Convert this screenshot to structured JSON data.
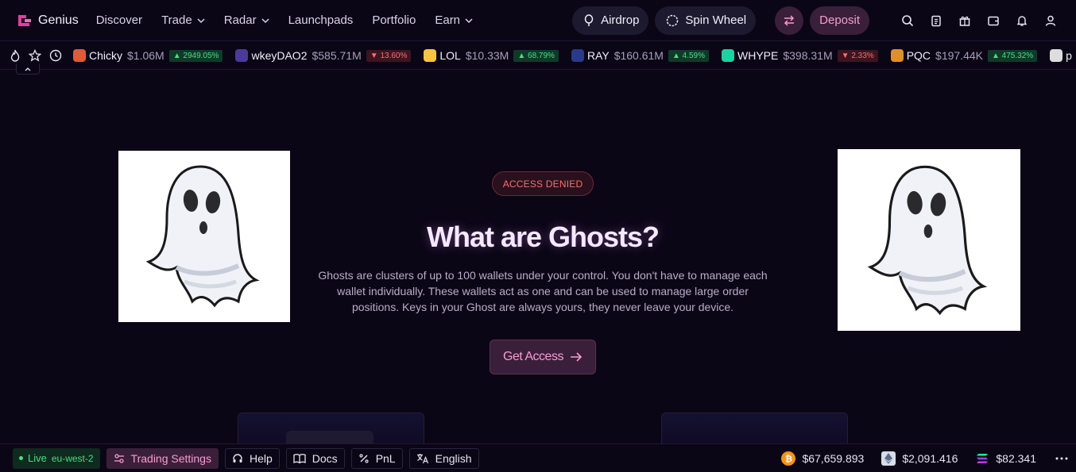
{
  "nav": {
    "brand": "Genius",
    "items": [
      {
        "label": "Discover",
        "dropdown": false
      },
      {
        "label": "Trade",
        "dropdown": true
      },
      {
        "label": "Radar",
        "dropdown": true
      },
      {
        "label": "Launchpads",
        "dropdown": false
      },
      {
        "label": "Portfolio",
        "dropdown": false
      },
      {
        "label": "Earn",
        "dropdown": true
      }
    ],
    "airdrop": "Airdrop",
    "spin_wheel": "Spin Wheel",
    "deposit": "Deposit"
  },
  "ticker": [
    {
      "symbol": "Chicky",
      "mc": "$1.06M",
      "change": "2949.05%",
      "dir": "up",
      "color": "#e05a3a"
    },
    {
      "symbol": "wkeyDAO2",
      "mc": "$585.71M",
      "change": "13.60%",
      "dir": "down",
      "color": "#4a3a9a"
    },
    {
      "symbol": "LOL",
      "mc": "$10.33M",
      "change": "68.79%",
      "dir": "up",
      "color": "#f5c542"
    },
    {
      "symbol": "RAY",
      "mc": "$160.61M",
      "change": "4.59%",
      "dir": "up",
      "color": "#2a3a8a"
    },
    {
      "symbol": "WHYPE",
      "mc": "$398.31M",
      "change": "2.33%",
      "dir": "down",
      "color": "#1fd1a0"
    },
    {
      "symbol": "PQC",
      "mc": "$197.44K",
      "change": "475.32%",
      "dir": "up",
      "color": "#e0902a"
    },
    {
      "symbol": "p",
      "mc": "",
      "change": "",
      "dir": "up",
      "color": "#dddddd"
    }
  ],
  "hero": {
    "badge": "ACCESS DENIED",
    "title": "What are Ghosts?",
    "description": "Ghosts are clusters of up to 100 wallets under your control. You don't have to manage each wallet individually. These wallets act as one and can be used to manage large order positions. Keys in your Ghost are always yours, they never leave your device.",
    "cta": "Get Access"
  },
  "footer": {
    "status": "Live",
    "region": "eu-west-2",
    "trading_settings": "Trading Settings",
    "help": "Help",
    "docs": "Docs",
    "pnl": "PnL",
    "language": "English",
    "prices": [
      {
        "coin": "btc",
        "value": "$67,659.893"
      },
      {
        "coin": "eth",
        "value": "$2,091.416"
      },
      {
        "coin": "sol",
        "value": "$82.341"
      }
    ]
  },
  "colors": {
    "accent_pink": "#f59ed0",
    "deny_red": "#f87171",
    "up_green": "#4ade80"
  }
}
